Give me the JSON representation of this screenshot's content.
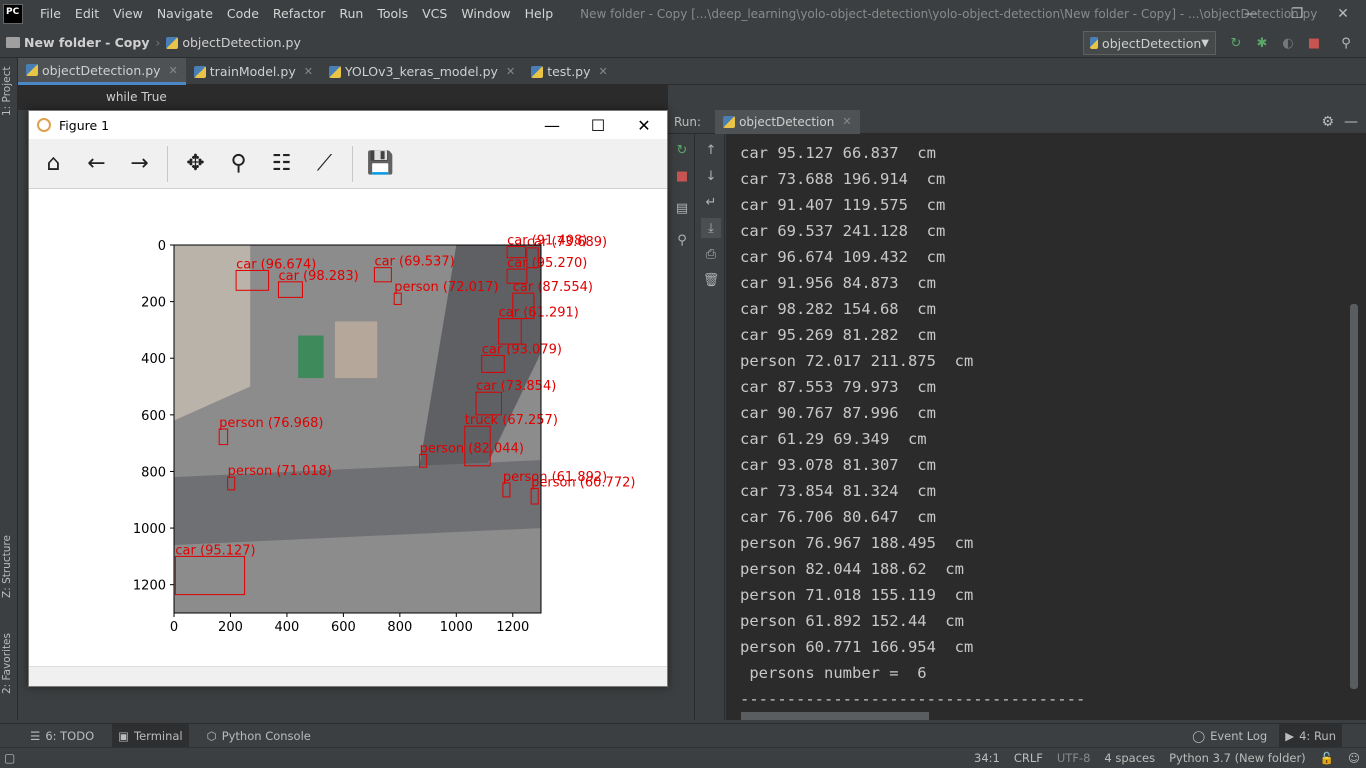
{
  "app": {
    "logo_text": "PC",
    "menu": [
      "File",
      "Edit",
      "View",
      "Navigate",
      "Code",
      "Refactor",
      "Run",
      "Tools",
      "VCS",
      "Window",
      "Help"
    ],
    "window_title": "New folder - Copy [...\\deep_learning\\yolo-object-detection\\yolo-object-detection\\New folder - Copy] - ...\\objectDetection.py",
    "win_min": "—",
    "win_restore": "❐",
    "win_close": "✕"
  },
  "navbar": {
    "project": "New folder - Copy",
    "file": "objectDetection.py",
    "run_config": "objectDetection"
  },
  "left_strip": {
    "project_label": "1: Project",
    "structure_label": "Z: Structure",
    "favorites_label": "2: Favorites"
  },
  "editor": {
    "tabs": [
      {
        "label": "objectDetection.py",
        "active": true
      },
      {
        "label": "trainModel.py",
        "active": false
      },
      {
        "label": "YOLOv3_keras_model.py",
        "active": false
      },
      {
        "label": "test.py",
        "active": false
      }
    ],
    "breadcrumb": "while True"
  },
  "run_panel": {
    "run_label": "Run:",
    "tab_label": "objectDetection",
    "console_lines": [
      "car 95.127 66.837  cm",
      "car 73.688 196.914  cm",
      "car 91.407 119.575  cm",
      "car 69.537 241.128  cm",
      "car 96.674 109.432  cm",
      "car 91.956 84.873  cm",
      "car 98.282 154.68  cm",
      "car 95.269 81.282  cm",
      "person 72.017 211.875  cm",
      "car 87.553 79.973  cm",
      "car 90.767 87.996  cm",
      "car 61.29 69.349  cm",
      "car 93.078 81.307  cm",
      "car 73.854 81.324  cm",
      "car 76.706 80.647  cm",
      "person 76.967 188.495  cm",
      "person 82.044 188.62  cm",
      "person 71.018 155.119  cm",
      "person 61.892 152.44  cm",
      "person 60.771 166.954  cm",
      " persons number =  6",
      "-------------------------------------"
    ]
  },
  "figure": {
    "title": "Figure 1",
    "min": "—",
    "max": "☐",
    "close": "✕",
    "toolbar": [
      "home-icon",
      "back-icon",
      "forward-icon",
      "pan-icon",
      "zoom-icon",
      "configure-icon",
      "edit-axis-icon",
      "save-icon"
    ],
    "detections": [
      {
        "label": "car (96.674)",
        "x": 220,
        "y": 90,
        "w": 115,
        "h": 70
      },
      {
        "label": "car (98.283)",
        "x": 370,
        "y": 130,
        "w": 85,
        "h": 55
      },
      {
        "label": "car (69.537)",
        "x": 710,
        "y": 80,
        "w": 60,
        "h": 50
      },
      {
        "label": "car (91.408)",
        "x": 1180,
        "y": 5,
        "w": 65,
        "h": 40
      },
      {
        "label": "car (73.689)",
        "x": 1250,
        "y": 10,
        "w": 40,
        "h": 70
      },
      {
        "label": "car (95.270)",
        "x": 1180,
        "y": 85,
        "w": 70,
        "h": 50
      },
      {
        "label": "car (87.554)",
        "x": 1200,
        "y": 170,
        "w": 75,
        "h": 90
      },
      {
        "label": "car (61.291)",
        "x": 1150,
        "y": 260,
        "w": 80,
        "h": 90
      },
      {
        "label": "car (93.079)",
        "x": 1090,
        "y": 390,
        "w": 80,
        "h": 60
      },
      {
        "label": "car (73.854)",
        "x": 1070,
        "y": 520,
        "w": 90,
        "h": 80
      },
      {
        "label": "truck (67.257)",
        "x": 1030,
        "y": 640,
        "w": 90,
        "h": 140
      },
      {
        "label": "person (72.017)",
        "x": 780,
        "y": 170,
        "w": 25,
        "h": 40
      },
      {
        "label": "person (76.968)",
        "x": 160,
        "y": 650,
        "w": 30,
        "h": 55
      },
      {
        "label": "person (82.044)",
        "x": 870,
        "y": 740,
        "w": 25,
        "h": 45
      },
      {
        "label": "person (71.018)",
        "x": 190,
        "y": 820,
        "w": 25,
        "h": 45
      },
      {
        "label": "person (61.892)",
        "x": 1165,
        "y": 840,
        "w": 25,
        "h": 50
      },
      {
        "label": "person (60.772)",
        "x": 1265,
        "y": 860,
        "w": 25,
        "h": 55
      },
      {
        "label": "car (95.127)",
        "x": 5,
        "y": 1100,
        "w": 245,
        "h": 135
      }
    ],
    "axes": {
      "xticks": [
        "0",
        "200",
        "400",
        "600",
        "800",
        "1000",
        "1200"
      ],
      "yticks": [
        "0",
        "200",
        "400",
        "600",
        "800",
        "1000",
        "1200"
      ],
      "xlim": [
        0,
        1300
      ],
      "ylim": [
        0,
        1300
      ]
    }
  },
  "bottom_tools": {
    "todo": "6: TODO",
    "terminal": "Terminal",
    "python_console": "Python Console",
    "event_log": "Event Log",
    "run": "4: Run"
  },
  "status": {
    "position": "34:1",
    "line_sep": "CRLF",
    "encoding": "UTF-8",
    "indent": "4 spaces",
    "interpreter": "Python 3.7 (New folder)"
  }
}
